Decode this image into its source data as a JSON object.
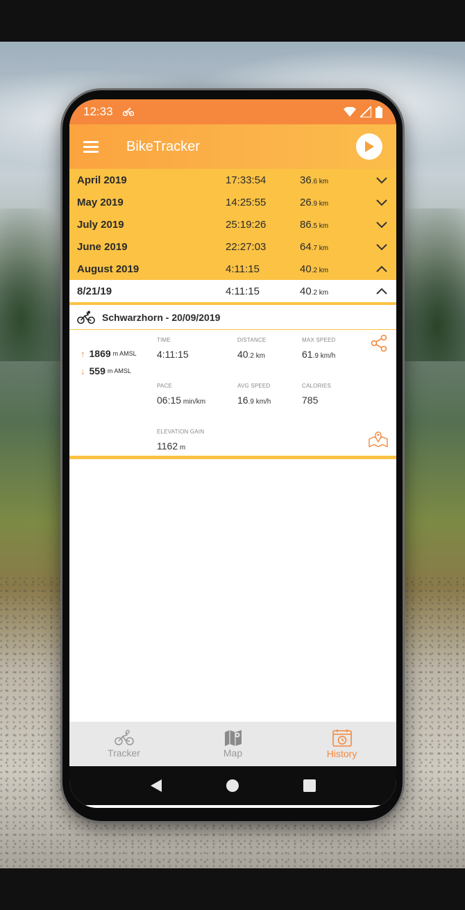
{
  "status": {
    "time": "12:33"
  },
  "appbar": {
    "title": "BikeTracker"
  },
  "months": [
    {
      "name": "April 2019",
      "time": "17:33:54",
      "dist_main": "36",
      "dist_small": ".6 km",
      "expanded": false
    },
    {
      "name": "May 2019",
      "time": "14:25:55",
      "dist_main": "26",
      "dist_small": ".9 km",
      "expanded": false
    },
    {
      "name": "July 2019",
      "time": "25:19:26",
      "dist_main": "86",
      "dist_small": ".5 km",
      "expanded": false
    },
    {
      "name": "June 2019",
      "time": "22:27:03",
      "dist_main": "64",
      "dist_small": ".7 km",
      "expanded": false
    },
    {
      "name": "August 2019",
      "time": "4:11:15",
      "dist_main": "40",
      "dist_small": ".2 km",
      "expanded": true
    }
  ],
  "day": {
    "date": "8/21/19",
    "time": "4:11:15",
    "dist_main": "40",
    "dist_small": ".2 km"
  },
  "ride": {
    "title": "Schwarzhorn - 20/09/2019",
    "elev_max": "1869",
    "elev_max_unit": "m AMSL",
    "elev_min": "559",
    "elev_min_unit": "m AMSL",
    "time_label": "TIME",
    "time_value": "4:11:15",
    "distance_label": "DISTANCE",
    "distance_main": "40",
    "distance_small": ".2 km",
    "maxspeed_label": "MAX SPEED",
    "maxspeed_main": "61",
    "maxspeed_small": ".9 km/h",
    "pace_label": "PACE",
    "pace_main": "06:15",
    "pace_small": " min/km",
    "avgspeed_label": "AVG SPEED",
    "avgspeed_main": "16",
    "avgspeed_small": ".9 km/h",
    "calories_label": "CALORIES",
    "calories_value": "785",
    "elevgain_label": "ELEVATION GAIN",
    "elevgain_main": "1162",
    "elevgain_small": " m"
  },
  "nav": {
    "tracker": "Tracker",
    "map": "Map",
    "history": "History"
  },
  "colors": {
    "accent": "#f5883c",
    "month_bg": "#fbc244",
    "appbar": "#fbb34a"
  }
}
